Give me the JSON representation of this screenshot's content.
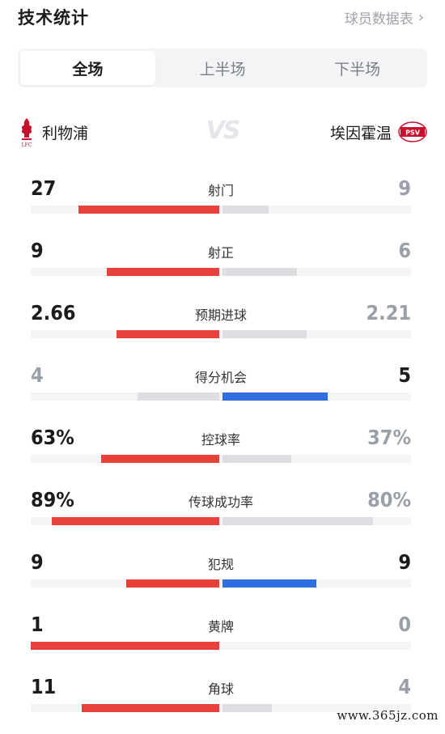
{
  "header": {
    "title": "技术统计",
    "player_link": "球员数据表",
    "chevron_icon": "chevron-right-icon"
  },
  "tabs": [
    {
      "label": "全场",
      "active": true
    },
    {
      "label": "上半场",
      "active": false
    },
    {
      "label": "下半场",
      "active": false
    }
  ],
  "teams": {
    "home": {
      "name": "利物浦",
      "crest_icon": "liverpool-crest-icon",
      "crest_text": "LFC"
    },
    "away": {
      "name": "埃因霍温",
      "crest_icon": "psv-crest-icon",
      "crest_text": "PSV"
    },
    "vs_text": "VS"
  },
  "colors": {
    "home_lead": "#e8413c",
    "away_lead": "#2f6ee0",
    "trailing": "#dcdee2"
  },
  "stats": [
    {
      "label": "射门",
      "home": "27",
      "away": "9",
      "home_frac": 0.75,
      "away_frac": 0.25,
      "leader": "home"
    },
    {
      "label": "射正",
      "home": "9",
      "away": "6",
      "home_frac": 0.6,
      "away_frac": 0.4,
      "leader": "home"
    },
    {
      "label": "预期进球",
      "home": "2.66",
      "away": "2.21",
      "home_frac": 0.55,
      "away_frac": 0.45,
      "leader": "home"
    },
    {
      "label": "得分机会",
      "home": "4",
      "away": "5",
      "home_frac": 0.44,
      "away_frac": 0.56,
      "leader": "away"
    },
    {
      "label": "控球率",
      "home": "63%",
      "away": "37%",
      "home_frac": 0.63,
      "away_frac": 0.37,
      "leader": "home"
    },
    {
      "label": "传球成功率",
      "home": "89%",
      "away": "80%",
      "home_frac": 0.89,
      "away_frac": 0.8,
      "leader": "home"
    },
    {
      "label": "犯规",
      "home": "9",
      "away": "9",
      "home_frac": 0.5,
      "away_frac": 0.5,
      "leader": "both"
    },
    {
      "label": "黄牌",
      "home": "1",
      "away": "0",
      "home_frac": 1.0,
      "away_frac": 0.0,
      "leader": "home"
    },
    {
      "label": "角球",
      "home": "11",
      "away": "4",
      "home_frac": 0.73,
      "away_frac": 0.27,
      "leader": "home"
    }
  ],
  "watermark": "www.365jz.com"
}
